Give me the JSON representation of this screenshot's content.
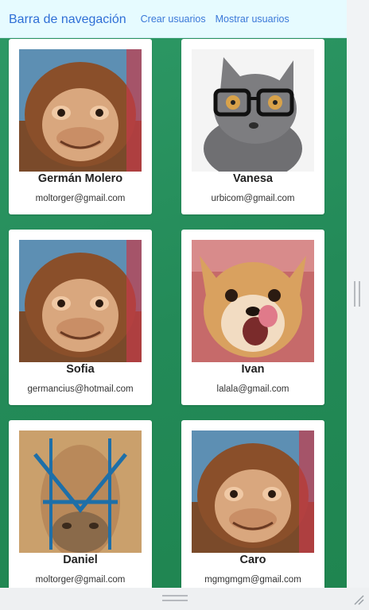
{
  "navbar": {
    "brand": "Barra de navegación",
    "links": [
      "Crear usuarios",
      "Mostrar usuarios"
    ]
  },
  "users": [
    {
      "name": "Germán Molero",
      "email": "moltorger@gmail.com",
      "photo": "orangutan-photo"
    },
    {
      "name": "Vanesa",
      "email": "urbicom@gmail.com",
      "photo": "cat-with-glasses-photo"
    },
    {
      "name": "Sofia",
      "email": "germancius@hotmail.com",
      "photo": "orangutan-photo"
    },
    {
      "name": "Ivan",
      "email": "lalala@gmail.com",
      "photo": "dog-photo"
    },
    {
      "name": "Daniel",
      "email": "moltorger@gmail.com",
      "photo": "camel-photo"
    },
    {
      "name": "Caro",
      "email": "mgmgmgm@gmail.com",
      "photo": "orangutan-photo"
    }
  ],
  "colors": {
    "background_green": "#238a58",
    "navbar_bg": "#e6fbff",
    "link_blue": "#3a78d8"
  }
}
